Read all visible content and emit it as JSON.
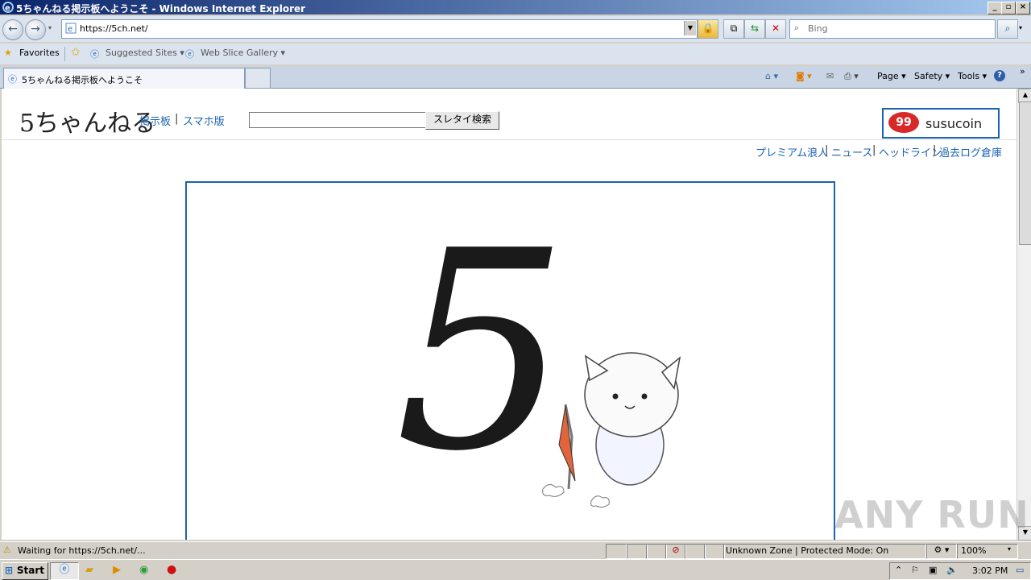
{
  "window": {
    "title": "5ちゃんねる掲示板へようこそ - Windows Internet Explorer",
    "min": "_",
    "max": "▫",
    "close": "×"
  },
  "nav": {
    "back_icon": "arrow-left-icon",
    "forward_icon": "arrow-right-icon",
    "url": "https://5ch.net/",
    "search_placeholder": "Bing"
  },
  "favorites": {
    "favorites_label": "Favorites",
    "suggested_label": "Suggested Sites ▾",
    "webslice_label": "Web Slice Gallery ▾"
  },
  "tabs": {
    "active_label": "5ちゃんねる掲示板へようこそ"
  },
  "commandbar": {
    "page": "Page ▾",
    "safety": "Safety ▾",
    "tools": "Tools ▾",
    "help": "?",
    "more": "»"
  },
  "site": {
    "logo": "5ちゃんねる",
    "link_board": "掲示板",
    "link_smartphone": "スマホ版",
    "separator": "|",
    "search_button": "スレタイ検索",
    "susucoin": "susucoin",
    "susucoin_badge": "99",
    "top_links": [
      "プレミアム浪人",
      "ニュース",
      "ヘッドライン",
      "過去ログ倉庫"
    ],
    "big_five": "5"
  },
  "status": {
    "text": "Waiting for https://5ch.net/...",
    "zone": "Unknown Zone | Protected Mode: On",
    "zoom": "100%"
  },
  "taskbar": {
    "start": "Start",
    "clock": "3:02 PM"
  },
  "watermark": "ANY RUN"
}
